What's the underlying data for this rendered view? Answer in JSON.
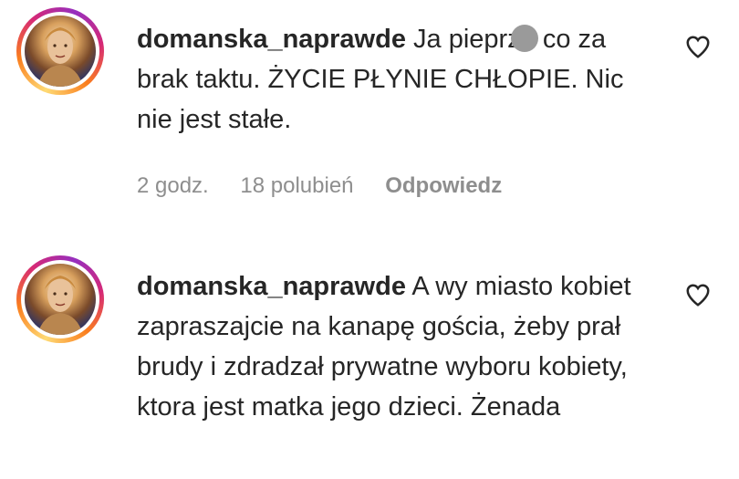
{
  "comments": [
    {
      "username": "domanska_naprawde",
      "text": " Ja pieprze co za brak taktu. ŻYCIE PŁYNIE CHŁOPIE. Nic nie jest stałe.",
      "time": "2 godz.",
      "likes": "18 polubień",
      "reply_label": "Odpowiedz",
      "like_icon": "heart-outline-icon"
    },
    {
      "username": "domanska_naprawde",
      "text": " A wy miasto kobiet zapraszajcie na kanapę gościa, żeby prał brudy i zdradzał prywatne wyboru kobiety, ktora jest matka jego dzieci. Żenada",
      "like_icon": "heart-outline-icon"
    }
  ],
  "colors": {
    "text": "#262626",
    "meta": "#8e8e8e",
    "ring": [
      "#feda75",
      "#fa7e1e",
      "#d62976",
      "#962fbf"
    ]
  }
}
